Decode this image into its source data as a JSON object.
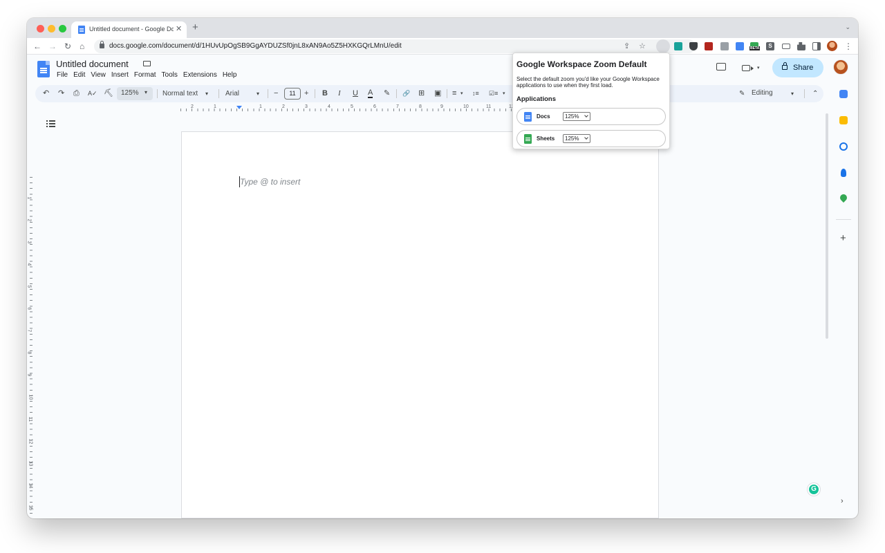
{
  "browser": {
    "tab_title": "Untitled document - Google Docs",
    "tab_close": "✕",
    "new_tab": "+",
    "tab_menu": "⌄",
    "url": "docs.google.com/document/d/1HUvUpOgSB9GgAYDUZSf0jnL8xAN9Ao5Z5HXKGQrLMnU/edit",
    "back": "←",
    "forward": "→",
    "reload": "↻",
    "home": "⌂",
    "share_page": "⇪",
    "bookmark": "☆",
    "more": "⋮",
    "extension_labels": {
      "ext5": "BETA",
      "ext7": "S"
    }
  },
  "docs": {
    "title": "Untitled document",
    "menu": [
      "File",
      "Edit",
      "View",
      "Insert",
      "Format",
      "Tools",
      "Extensions",
      "Help"
    ],
    "share_label": "Share",
    "toolbar": {
      "undo": "↶",
      "redo": "↷",
      "print": "⎙",
      "spellcheck": "A✓",
      "paint_format": "⛏",
      "zoom": "125%",
      "style": "Normal text",
      "font": "Arial",
      "minus": "−",
      "font_size": "11",
      "plus": "+",
      "bold": "B",
      "italic": "I",
      "underline": "U",
      "text_color": "A",
      "highlight": "✎",
      "link": "🔗",
      "comment": "⊞",
      "image": "▣",
      "align": "≡",
      "line_spacing": "↕≡",
      "checklist": "☑≡",
      "editing_label": "Editing",
      "collapse": "⌃",
      "dropdown": "▾"
    },
    "ruler_h": [
      "2",
      "1",
      "1",
      "2",
      "3",
      "4",
      "5",
      "6",
      "7",
      "8",
      "9",
      "10",
      "11",
      "12"
    ],
    "ruler_v": [
      "1",
      "2",
      "3",
      "4",
      "5",
      "6",
      "7",
      "8",
      "9",
      "10",
      "11",
      "12",
      "13",
      "14",
      "15"
    ],
    "placeholder": "Type @ to insert",
    "side_add": "+",
    "side_expand": "›",
    "grammarly_label": "G"
  },
  "popup": {
    "title": "Google Workspace Zoom Default",
    "description": "Select the default zoom you'd like your Google Workspace applications to use when they first load.",
    "section_label": "Applications",
    "apps": [
      {
        "name": "Docs",
        "zoom": "125%"
      },
      {
        "name": "Sheets",
        "zoom": "125%"
      }
    ]
  },
  "colors": {
    "docs_blue": "#4285f4",
    "sheets_green": "#34a853",
    "share_button_bg": "#c2e7ff",
    "toolbar_bg": "#edf2fa",
    "grammarly": "#15c39a"
  },
  "icons": [
    "docs-logo-icon",
    "folder-icon",
    "comment-icon",
    "video-call-icon",
    "lock-icon",
    "outline-icon",
    "calendar-icon",
    "keep-icon",
    "tasks-icon",
    "contacts-icon",
    "maps-icon",
    "grammarly-icon"
  ]
}
